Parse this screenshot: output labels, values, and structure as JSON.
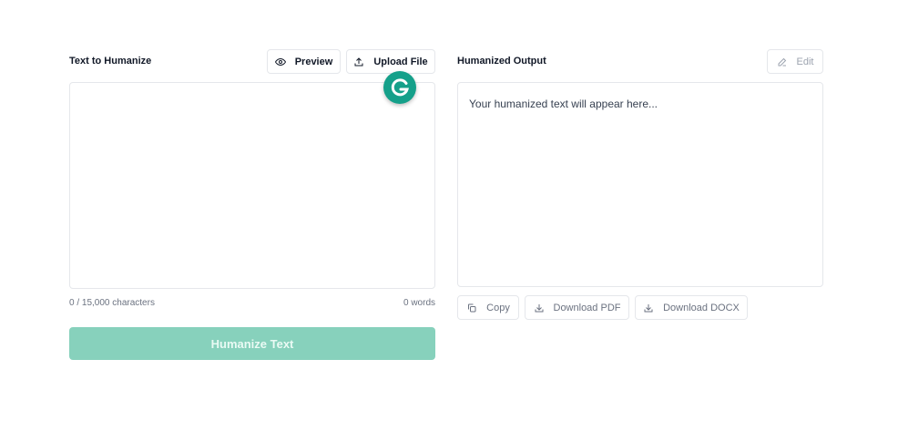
{
  "input": {
    "title": "Text to Humanize",
    "preview_label": "Preview",
    "upload_label": "Upload File",
    "char_count": "0 / 15,000 characters",
    "word_count": "0 words",
    "humanize_label": "Humanize Text"
  },
  "output": {
    "title": "Humanized Output",
    "edit_label": "Edit",
    "placeholder": "Your humanized text will appear here...",
    "copy_label": "Copy",
    "download_pdf_label": "Download PDF",
    "download_docx_label": "Download DOCX"
  },
  "icons": {
    "preview": "eye-icon",
    "upload": "upload-icon",
    "edit": "pencil-icon",
    "copy": "copy-icon",
    "download": "download-icon",
    "grammarly": "grammarly-icon"
  },
  "colors": {
    "accent": "#87d1bc",
    "grammarly": "#15a08a"
  }
}
